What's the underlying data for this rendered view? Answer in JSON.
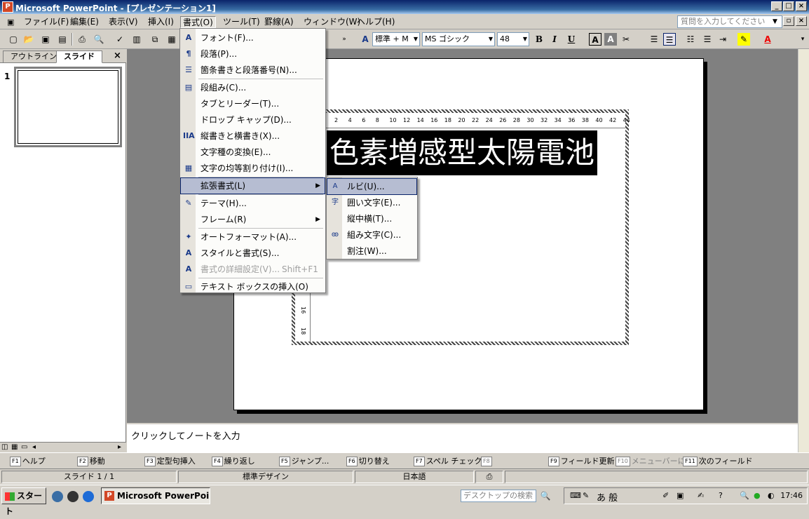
{
  "window": {
    "title": "Microsoft PowerPoint - [プレゼンテーション1]",
    "app_icon": "P"
  },
  "menubar": {
    "items": [
      "ファイル(F)",
      "編集(E)",
      "表示(V)",
      "挿入(I)",
      "書式(O)",
      "ツール(T)",
      "罫線(A)",
      "ウィンドウ(W)",
      "ヘルプ(H)"
    ],
    "help_placeholder": "質問を入力してください"
  },
  "toolbar": {
    "style_box": "標準 + M",
    "font_box": "MS ゴシック",
    "size_box": "48",
    "bold": "B",
    "italic": "I",
    "underline": "U",
    "font_color": "A"
  },
  "leftpane": {
    "tabs": [
      "アウトライン",
      "スライド"
    ],
    "close": "×",
    "slide_number": "1"
  },
  "ruler": {
    "ticks": [
      "2",
      "4",
      "6",
      "8",
      "10",
      "12",
      "14",
      "16",
      "18",
      "20",
      "22",
      "24",
      "26",
      "28",
      "30",
      "32",
      "34",
      "36",
      "38",
      "40",
      "42",
      "44"
    ],
    "vticks": [
      "16",
      "18"
    ]
  },
  "slide": {
    "title_text": "色素増感型太陽電池"
  },
  "format_menu": {
    "items": [
      {
        "icon": "A",
        "icon_name": "font-icon",
        "label": "フォント(F)..."
      },
      {
        "icon": "¶",
        "icon_name": "paragraph-icon",
        "label": "段落(P)..."
      },
      {
        "icon": "☰",
        "icon_name": "bullets-icon",
        "label": "箇条書きと段落番号(N)..."
      },
      {
        "icon": "▤",
        "icon_name": "columns-icon",
        "label": "段組み(C)..."
      },
      {
        "icon": "",
        "icon_name": "",
        "label": "タブとリーダー(T)..."
      },
      {
        "icon": "",
        "icon_name": "",
        "label": "ドロップ キャップ(D)..."
      },
      {
        "icon": "IIA",
        "icon_name": "vertical-text-icon",
        "label": "縦書きと横書き(X)..."
      },
      {
        "icon": "",
        "icon_name": "",
        "label": "文字種の変換(E)..."
      },
      {
        "icon": "▦",
        "icon_name": "distribute-icon",
        "label": "文字の均等割り付け(I)..."
      },
      {
        "icon": "",
        "icon_name": "",
        "label": "拡張書式(L)",
        "submenu": true
      },
      {
        "icon": "✎",
        "icon_name": "theme-icon",
        "label": "テーマ(H)..."
      },
      {
        "icon": "",
        "icon_name": "",
        "label": "フレーム(R)",
        "submenu": true
      },
      {
        "icon": "✦",
        "icon_name": "autoformat-icon",
        "label": "オートフォーマット(A)..."
      },
      {
        "icon": "A",
        "icon_name": "styles-icon",
        "label": "スタイルと書式(S)..."
      },
      {
        "icon": "A",
        "icon_name": "reveal-format-icon",
        "label": "書式の詳細設定(V)...",
        "shortcut": "Shift+F1",
        "disabled": true
      },
      {
        "icon": "▭",
        "icon_name": "textbox-icon",
        "label": "テキスト ボックスの挿入(O)"
      }
    ]
  },
  "sub_menu": {
    "items": [
      {
        "icon": "A",
        "icon_name": "ruby-icon",
        "label": "ルビ(U)..."
      },
      {
        "icon": "字",
        "icon_name": "enclosed-char-icon",
        "label": "囲い文字(E)..."
      },
      {
        "icon": "",
        "icon_name": "",
        "label": "縦中横(T)..."
      },
      {
        "icon": "ꙭ",
        "icon_name": "combine-chars-icon",
        "label": "組み文字(C)..."
      },
      {
        "icon": "",
        "icon_name": "",
        "label": "割注(W)..."
      }
    ]
  },
  "notes": {
    "placeholder": "クリックしてノートを入力"
  },
  "fkeys": [
    {
      "key": "F1",
      "label": "ヘルプ"
    },
    {
      "key": "F2",
      "label": "移動"
    },
    {
      "key": "F3",
      "label": "定型句挿入"
    },
    {
      "key": "F4",
      "label": "繰り返し"
    },
    {
      "key": "F5",
      "label": "ジャンプ..."
    },
    {
      "key": "F6",
      "label": "切り替え"
    },
    {
      "key": "F7",
      "label": "スペル チェック..."
    },
    {
      "key": "F8",
      "label": ""
    },
    {
      "key": "F9",
      "label": "フィールド更新"
    },
    {
      "key": "F10",
      "label": "メニューバーに"
    },
    {
      "key": "F11",
      "label": "次のフィールド"
    }
  ],
  "statusbar": {
    "slide": "スライド 1 / 1",
    "design": "標準デザイン",
    "language": "日本語"
  },
  "taskbar": {
    "start": "スタート",
    "task": "Microsoft PowerPoi...",
    "search_placeholder": "デスクトップの検索",
    "tray_ime": "あ 般",
    "clock": "17:46"
  }
}
